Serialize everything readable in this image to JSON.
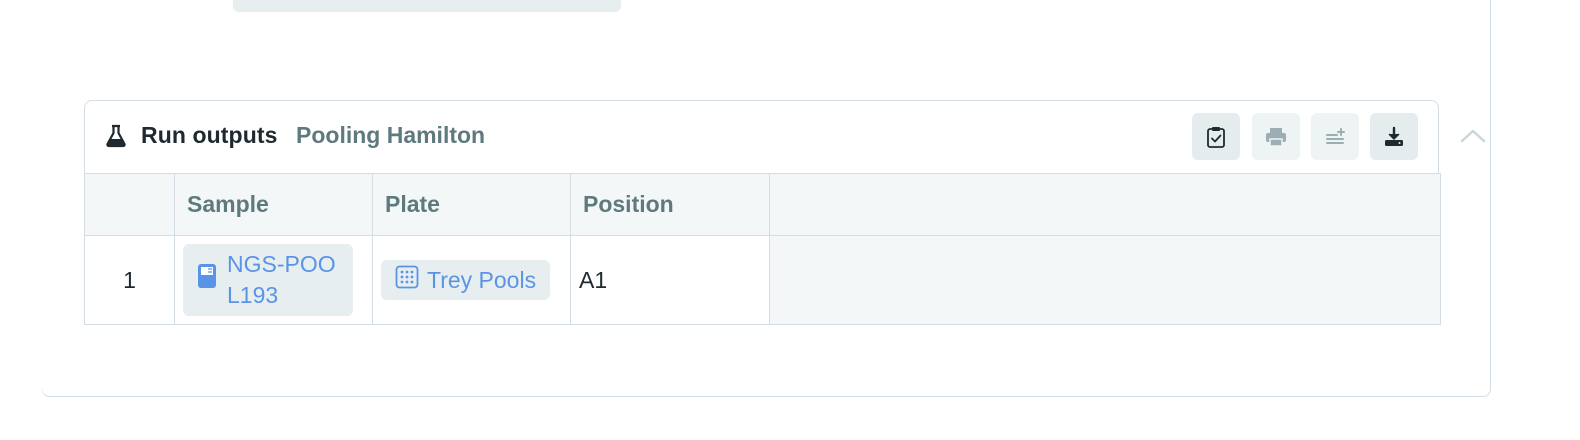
{
  "colors": {
    "accent": "#7aa6f4",
    "link": "#5b94e6",
    "muted_text": "#5f7a7f",
    "border": "#d3dde3"
  },
  "run_outputs": {
    "icon": "flask-icon",
    "title": "Run outputs",
    "subtitle": "Pooling Hamilton",
    "toolbar": [
      {
        "name": "validate-button",
        "icon": "clipboard-check-icon"
      },
      {
        "name": "print-button",
        "icon": "printer-icon"
      },
      {
        "name": "columns-button",
        "icon": "sliders-add-icon"
      },
      {
        "name": "download-button",
        "icon": "download-icon"
      }
    ],
    "collapse_icon": "chevron-up-icon",
    "table": {
      "columns": [
        "",
        "Sample",
        "Plate",
        "Position",
        ""
      ],
      "rows": [
        {
          "index": "1",
          "sample": "NGS-POOL193",
          "sample_icon": "tube-icon",
          "plate": "Trey Pools",
          "plate_icon": "plate-grid-icon",
          "position": "A1"
        }
      ]
    }
  }
}
